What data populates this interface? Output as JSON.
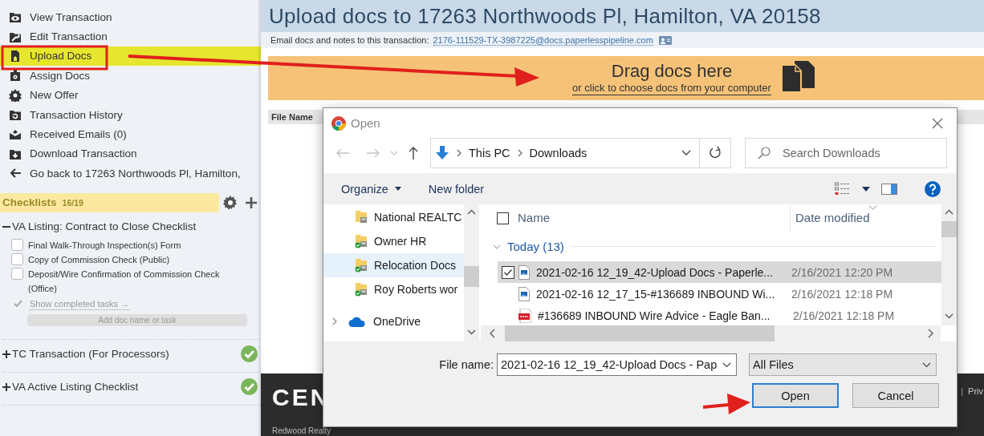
{
  "sidebar": {
    "menu": [
      {
        "label": "View Transaction",
        "selected": false
      },
      {
        "label": "Edit Transaction",
        "selected": false
      },
      {
        "label": "Upload Docs",
        "selected": true
      },
      {
        "label": "Assign Docs",
        "selected": false
      },
      {
        "label": "New Offer",
        "selected": false
      },
      {
        "label": "Transaction History",
        "selected": false
      },
      {
        "label": "Received Emails (0)",
        "selected": false
      },
      {
        "label": "Download Transaction",
        "selected": false
      },
      {
        "label": "Go back to 17263 Northwoods Pl, Hamilton,",
        "selected": false
      }
    ],
    "checklists": {
      "title": "Checklists",
      "count": "16/19",
      "lists": [
        {
          "label": "VA Listing: Contract to Close Checklist",
          "expanded": true,
          "complete": false,
          "tasks": [
            {
              "label": "Final Walk-Through Inspection(s) Form",
              "checked": false
            },
            {
              "label": "Copy of Commission Check (Public)",
              "checked": false
            },
            {
              "label": "Deposit/Wire Confirmation of Commission Check (Office)",
              "checked": false
            }
          ],
          "show_completed": "Show completed tasks →",
          "add_placeholder": "Add doc name or task"
        },
        {
          "label": "TC Transaction (For Processors)",
          "expanded": false,
          "complete": true
        },
        {
          "label": "VA Active Listing Checklist",
          "expanded": false,
          "complete": true
        }
      ]
    }
  },
  "page": {
    "title": "Upload docs to 17263 Northwoods Pl, Hamilton, VA 20158",
    "email_label": "Email docs and notes to this transaction:",
    "email": "2176-111529-TX-3987225@docs.paperlesspipeline.com",
    "dropzone": {
      "title": "Drag docs here",
      "subtitle": "or click to choose docs from your computer"
    },
    "table": {
      "columns": [
        "File Name"
      ]
    }
  },
  "footer": {
    "logo": "CEN",
    "tagline": "Redwood Realty",
    "separator": "|",
    "link": "Priv"
  },
  "dialog": {
    "title": "Open",
    "path": [
      "This PC",
      "Downloads"
    ],
    "search_placeholder": "Search Downloads",
    "organize": "Organize",
    "new_folder": "New folder",
    "nav_items": [
      {
        "label": "National REALTC",
        "kind": "folder",
        "selected": false
      },
      {
        "label": "Owner HR",
        "kind": "synced_folder",
        "selected": false
      },
      {
        "label": "Relocation Docs",
        "kind": "synced_folder",
        "selected": true
      },
      {
        "label": "Roy Roberts wor",
        "kind": "synced_folder",
        "selected": false
      },
      {
        "label": "OneDrive",
        "kind": "cloud",
        "selected": false
      }
    ],
    "columns": [
      "Name",
      "Date modified"
    ],
    "select_all_checked": false,
    "group": {
      "label": "Today (13)",
      "expanded": true
    },
    "files": [
      {
        "name": "2021-02-16 12_19_42-Upload Docs - Paperle...",
        "date": "2/16/2021 12:20 PM",
        "kind": "image",
        "selected": true
      },
      {
        "name": "2021-02-16 12_17_15-#136689 INBOUND Wi...",
        "date": "2/16/2021 12:18 PM",
        "kind": "image",
        "selected": false
      },
      {
        "name": "#136689 INBOUND Wire Advice - Eagle Ban...",
        "date": "2/16/2021 12:18 PM",
        "kind": "pdf",
        "selected": false
      }
    ],
    "file_name_label": "File name:",
    "file_name": "2021-02-16 12_19_42-Upload Docs - Pap",
    "filter": "All Files",
    "buttons": [
      {
        "label": "Open",
        "default": true
      },
      {
        "label": "Cancel",
        "default": false
      }
    ]
  }
}
